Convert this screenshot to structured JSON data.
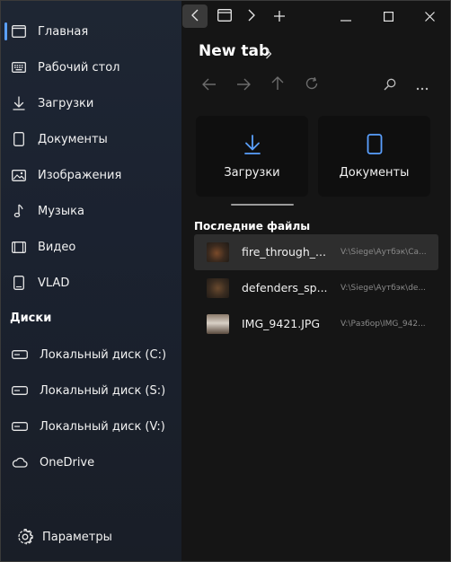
{
  "sidebar": {
    "items": [
      {
        "label": "Главная",
        "icon": "home-icon"
      },
      {
        "label": "Рабочий стол",
        "icon": "desktop-icon"
      },
      {
        "label": "Загрузки",
        "icon": "download-icon"
      },
      {
        "label": "Документы",
        "icon": "document-icon"
      },
      {
        "label": "Изображения",
        "icon": "image-icon"
      },
      {
        "label": "Музыка",
        "icon": "music-icon"
      },
      {
        "label": "Видео",
        "icon": "video-icon"
      },
      {
        "label": "VLAD",
        "icon": "document-icon"
      }
    ],
    "drives_title": "Диски",
    "drives": [
      {
        "label": "Локальный диск (C:)",
        "icon": "drive-icon"
      },
      {
        "label": "Локальный диск (S:)",
        "icon": "drive-icon"
      },
      {
        "label": "Локальный диск (V:)",
        "icon": "drive-icon"
      },
      {
        "label": "OneDrive",
        "icon": "cloud-icon"
      }
    ],
    "settings_label": "Параметры"
  },
  "main": {
    "title": "New tab",
    "cards": [
      {
        "label": "Загрузки",
        "icon": "download-icon"
      },
      {
        "label": "Документы",
        "icon": "document-icon"
      }
    ],
    "recent_title": "Последние файлы",
    "recent": [
      {
        "name": "fire_through_...",
        "path": "V:\\Siege\\Аутбэк\\Ca..."
      },
      {
        "name": "defenders_sp...",
        "path": "V:\\Siege\\Аутбэк\\de..."
      },
      {
        "name": "IMG_9421.JPG",
        "path": "V:\\Разбор\\IMG_942..."
      }
    ]
  },
  "colors": {
    "accent": "#5aa0ff",
    "sidebar_bg": "#1e2633",
    "main_bg": "#151515",
    "card_bg": "#0f0f0f",
    "selected_row": "#2e2e2e"
  }
}
